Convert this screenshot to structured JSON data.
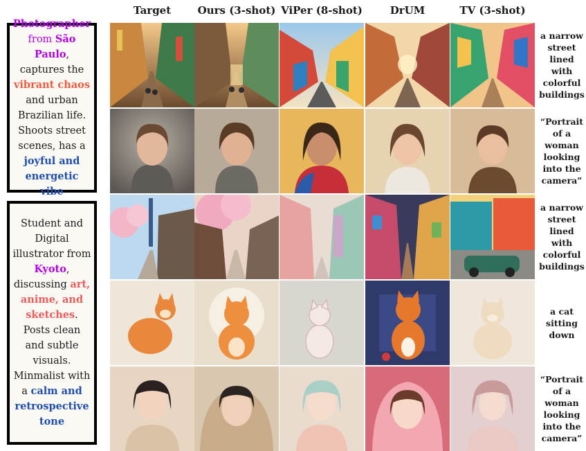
{
  "columns": [
    "Target",
    "Ours (3-shot)",
    "ViPer (8-shot)",
    "DrUM",
    "TV (3-shot)"
  ],
  "personas": [
    {
      "segments": [
        {
          "text": "Photographer",
          "style": "hl-purple"
        },
        {
          "text": " from ",
          "style": "hl-purple-plain"
        },
        {
          "text": "São Paulo",
          "style": "hl-purple"
        },
        {
          "text": ", captures the ",
          "style": ""
        },
        {
          "text": "vibrant chaos",
          "style": "hl-red"
        },
        {
          "text": " and urban Brazilian life. Shoots street scenes, has a ",
          "style": ""
        },
        {
          "text": "joyful and energetic vibe",
          "style": "hl-blue"
        }
      ]
    },
    {
      "segments": [
        {
          "text": "Student and Digital illustrator from ",
          "style": ""
        },
        {
          "text": "Kyoto",
          "style": "hl-purple"
        },
        {
          "text": ", discussing ",
          "style": ""
        },
        {
          "text": "art, anime, and sketches",
          "style": "hl-pink"
        },
        {
          "text": ". Posts clean and subtle visuals. Minmalist with a ",
          "style": ""
        },
        {
          "text": "calm and retrospective tone",
          "style": "hl-blue"
        }
      ]
    }
  ],
  "prompts": [
    "a narrow street lined with colorful buildings",
    "“Portrait of a woman looking into the camera”",
    "a narrow street lined with colorful buildings",
    "a cat sitting down",
    "“Portrait of a woman looking into the camera”"
  ],
  "colors": {
    "street_warm": "#c8763a",
    "portrait_bg": "#9a8f84",
    "sakura": "#f2b6c8",
    "cat_orange": "#e9883c",
    "anime_hood": "#d9c2a5",
    "sky_blue": "#6aa5d8",
    "highlight_purple": "#b400e6",
    "highlight_red": "#f05a3c",
    "highlight_blue": "#1e4fae"
  }
}
